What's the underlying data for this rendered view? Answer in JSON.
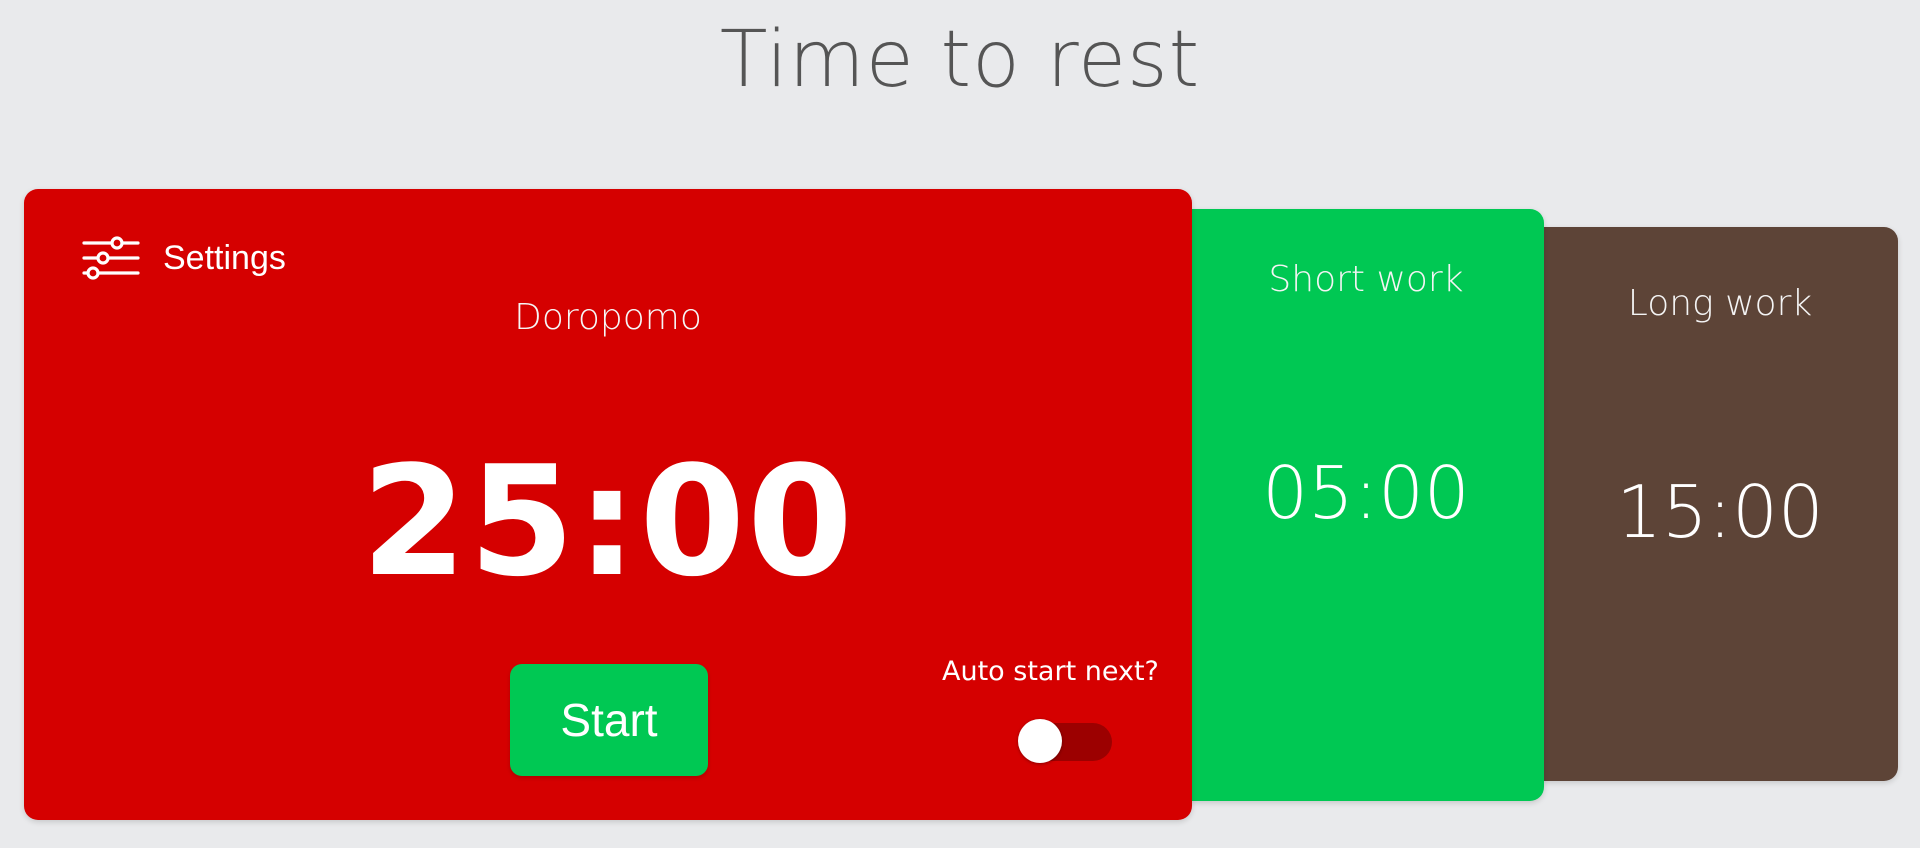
{
  "page": {
    "title": "Time to rest"
  },
  "main_card": {
    "settings_label": "Settings",
    "settings_icon": "sliders-icon",
    "mode_label": "Doropomo",
    "time": "25:00",
    "start_label": "Start",
    "auto_start_label": "Auto start next?",
    "auto_start_enabled": false,
    "color": "#d50000"
  },
  "short_card": {
    "label": "Short work",
    "time": "05:00",
    "color": "#00c853"
  },
  "long_card": {
    "label": "Long work",
    "time": "15:00",
    "color": "#5d4437"
  },
  "colors": {
    "background": "#e9eaec",
    "start_button": "#00c853",
    "toggle_track": "#9c0000"
  }
}
